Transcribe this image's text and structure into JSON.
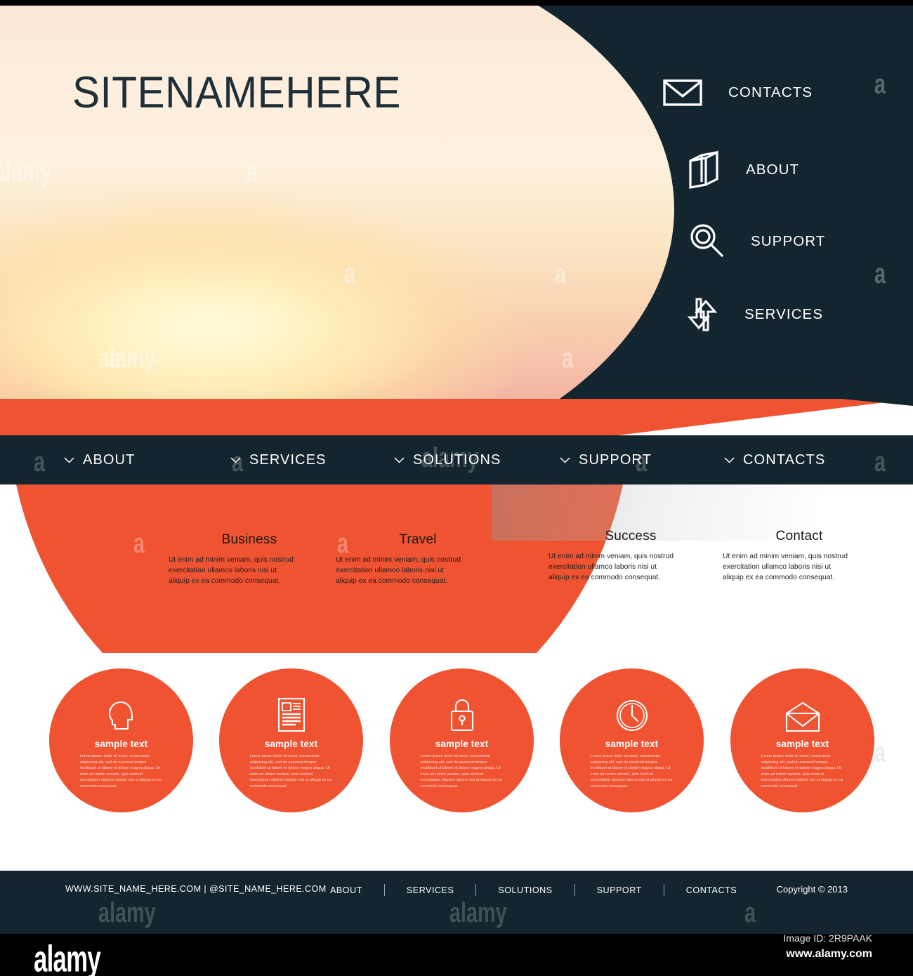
{
  "site": {
    "title": "SITENAMEHERE"
  },
  "colors": {
    "dark_navy": "#13252e",
    "orange": "#ef5331",
    "white": "#ffffff",
    "body_text": "#1f1f1f"
  },
  "sidenav": {
    "items": [
      {
        "label": "CONTACTS",
        "icon": "envelope-icon"
      },
      {
        "label": "ABOUT",
        "icon": "book-icon"
      },
      {
        "label": "SUPPORT",
        "icon": "magnifier-icon"
      },
      {
        "label": "SERVICES",
        "icon": "transfer-arrows-icon"
      }
    ]
  },
  "navbar": {
    "items": [
      {
        "label": "ABOUT",
        "icon": "chevron-down-icon"
      },
      {
        "label": "SERVICES",
        "icon": "chevron-down-icon"
      },
      {
        "label": "SOLUTIONS",
        "icon": "chevron-down-icon"
      },
      {
        "label": "SUPPORT",
        "icon": "chevron-down-icon"
      },
      {
        "label": "CONTACTS",
        "icon": "chevron-down-icon"
      }
    ]
  },
  "features": {
    "body_text": "Ut enim ad minim veniam, quis nostrud exercitation ullamco laboris nisi ut aliquip ex ea commodo consequat.",
    "items": [
      {
        "title": "Business"
      },
      {
        "title": "Travel"
      },
      {
        "title": "Success"
      },
      {
        "title": "Contact"
      }
    ]
  },
  "circles": {
    "title": "sample text",
    "body_text": "Lorem ipsum dolor sit amet, consectetur adipiscing elit, sed do eiusmod tempor incididunt ut labore et dolore magna aliqua. Ut enim ad minim veniam, quis nostrud exercitation ullamco laboris nisi ut aliquip ex ea commodo consequat.",
    "items": [
      {
        "icon": "head-profile-icon"
      },
      {
        "icon": "document-icon"
      },
      {
        "icon": "lock-icon"
      },
      {
        "icon": "clock-icon"
      },
      {
        "icon": "open-envelope-icon"
      }
    ]
  },
  "footer": {
    "site_url": "WWW.SITE_NAME_HERE.COM    |    @SITE_NAME_HERE.COM",
    "links": [
      "ABOUT",
      "SERVICES",
      "SOLUTIONS",
      "SUPPORT",
      "CONTACTS"
    ],
    "copyright": "Copyright © 2013"
  },
  "stock_bar": {
    "logo": "alamy",
    "image_id": "Image ID: 2R9PAAK",
    "url": "www.alamy.com"
  },
  "watermark": {
    "letter": "a",
    "word": "alamy"
  }
}
